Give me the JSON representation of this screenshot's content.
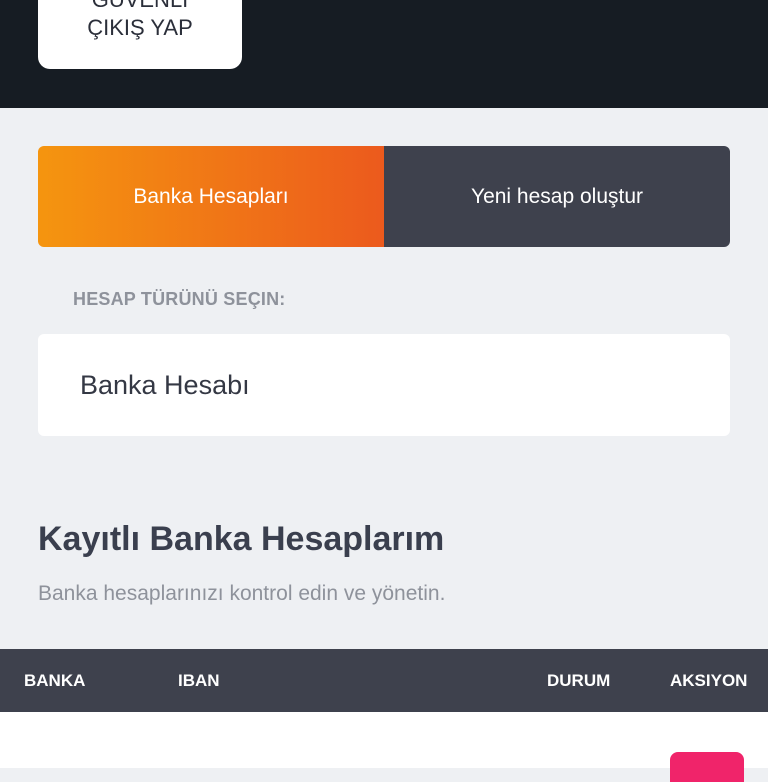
{
  "header": {
    "logout_line1": "GÜVENLİ",
    "logout_line2": "ÇIKIŞ YAP"
  },
  "tabs": [
    {
      "label": "Banka Hesapları",
      "active": true
    },
    {
      "label": "Yeni hesap oluştur",
      "active": false
    }
  ],
  "account_type": {
    "label": "HESAP TÜRÜNÜ SEÇIN:",
    "selected": "Banka Hesabı"
  },
  "section": {
    "title": "Kayıtlı Banka Hesaplarım",
    "subtitle": "Banka hesaplarınızı kontrol edin ve yönetin."
  },
  "table": {
    "columns": [
      "BANKA",
      "IBAN",
      "DURUM",
      "AKSIYON"
    ]
  },
  "colors": {
    "topbar": "#161c23",
    "tab_active_start": "#f5950f",
    "tab_active_end": "#ec5a1d",
    "tab_inactive": "#3e414d",
    "action_button": "#f0246a"
  }
}
